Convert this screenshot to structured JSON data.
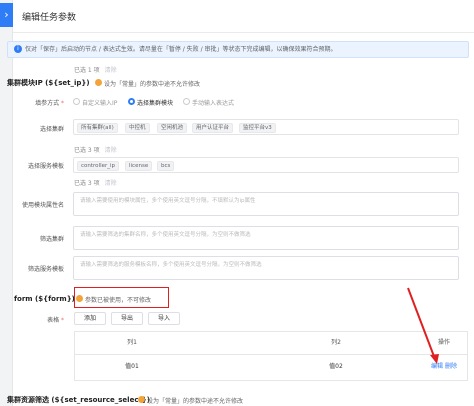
{
  "header": {
    "title": "编辑任务参数",
    "expand_icon": "chevron-right"
  },
  "notice": {
    "text": "仅对「保存」后启动的节点 / 表达式生效。请尽量在「暂停 / 失败 / 审批」等状态下完成编辑，以确保效果符合预期。"
  },
  "cluster_section": {
    "selected_count": "已选 1 项",
    "clear_label": "清除",
    "title": "集群模块IP (${set_ip})",
    "hint": "设为「常量」的参数中途不允许修改",
    "fill_mode": {
      "label": "填参方式",
      "options": [
        {
          "label": "自定义输入IP",
          "selected": false
        },
        {
          "label": "选择集群模块",
          "selected": true
        },
        {
          "label": "手动输入表达式",
          "selected": false
        }
      ]
    },
    "cluster": {
      "label": "选择集群",
      "tags": [
        "所有集群(all)",
        "中控机",
        "空闲机池",
        "用户认证平台",
        "监控平台v3"
      ]
    },
    "service_template": {
      "selected_count": "已选 3 项",
      "clear_label": "清除",
      "label": "选择服务模板",
      "tags": [
        "controller_ip",
        "license",
        "bcs"
      ]
    },
    "module_attr": {
      "label": "使用模块属性名",
      "placeholder": "请输入需要使用的模块属性，多个使用英文逗号分隔，不填默认为ip属性"
    },
    "filter_cluster": {
      "label": "筛选集群",
      "placeholder": "请输入需要筛选的集群名称，多个使用英文逗号分隔，为空则不做筛选"
    },
    "filter_template": {
      "label": "筛选服务模板",
      "placeholder": "请输入需要筛选的服务模板名称，多个使用英文逗号分隔，为空则不做筛选"
    }
  },
  "form_section": {
    "title": "form (${form})",
    "hint": "参数已被使用，不可修改",
    "table_label": "表格",
    "buttons": {
      "add": "添加",
      "export": "导出",
      "import": "导入"
    },
    "table": {
      "headers": [
        "列1",
        "列2",
        "操作"
      ],
      "rows": [
        {
          "col1": "值01",
          "col2": "值02",
          "edit": "编辑",
          "delete": "删除"
        }
      ]
    }
  },
  "resource_section": {
    "title": "集群资源筛选 (${set_resource_select})",
    "hint": "设为「常量」的参数中途不允许修改"
  },
  "colors": {
    "primary": "#2f7df6",
    "warning": "#f2a33a",
    "danger": "#e02020",
    "required": "#f56c6c"
  }
}
